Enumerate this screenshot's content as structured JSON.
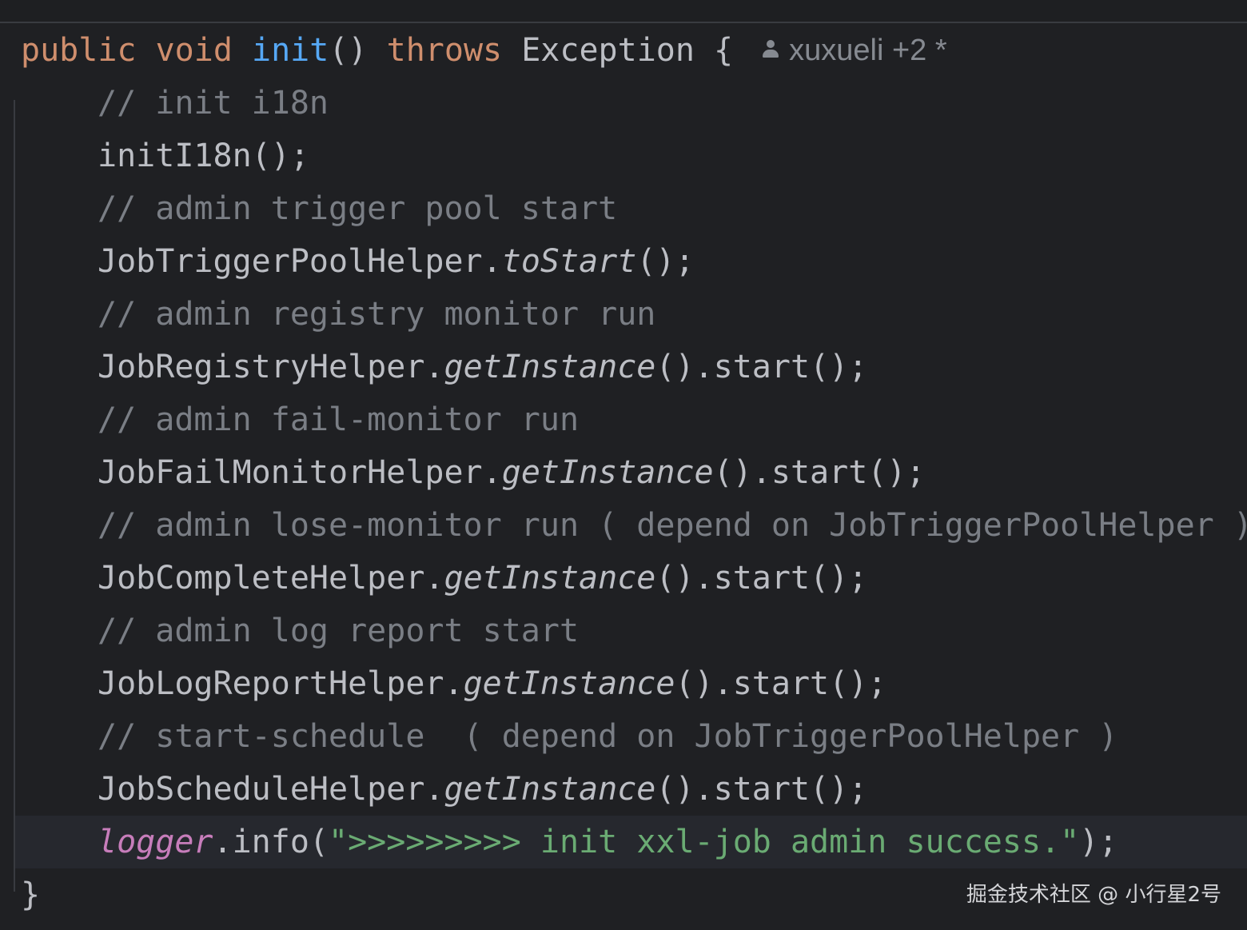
{
  "editor": {
    "decl": {
      "kw_public": "public",
      "kw_void": "void",
      "method_name": "init",
      "parens": "()",
      "kw_throws": "throws",
      "exception": "Exception",
      "open_brace": "{"
    },
    "author_hint": {
      "icon": "person-icon",
      "text": "xuxueli +2 *"
    },
    "lines": {
      "c1": "// init i18n",
      "s1": "initI18n();",
      "c2": "// admin trigger pool start",
      "s2_class": "JobTriggerPoolHelper.",
      "s2_call": "toStart",
      "s2_rest": "();",
      "c3": "// admin registry monitor run",
      "s3_class": "JobRegistryHelper.",
      "s3_call": "getInstance",
      "s3_rest": "().start();",
      "c4": "// admin fail-monitor run",
      "s4_class": "JobFailMonitorHelper.",
      "s4_call": "getInstance",
      "s4_rest": "().start();",
      "c5": "// admin lose-monitor run ( depend on JobTriggerPoolHelper )",
      "s5_class": "JobCompleteHelper.",
      "s5_call": "getInstance",
      "s5_rest": "().start();",
      "c6": "// admin log report start",
      "s6_class": "JobLogReportHelper.",
      "s6_call": "getInstance",
      "s6_rest": "().start();",
      "c7": "// start-schedule  ( depend on JobTriggerPoolHelper )",
      "s7_class": "JobScheduleHelper.",
      "s7_call": "getInstance",
      "s7_rest": "().start();",
      "log_field": "logger",
      "log_call": ".info(",
      "log_string": "\">>>>>>>>> init xxl-job admin success.\"",
      "log_end": ");",
      "close_brace": "}"
    }
  },
  "watermark": "掘金技术社区 @ 小行星2号",
  "colors": {
    "background": "#1f2023",
    "keyword": "#cf8e6d",
    "method_declaration": "#56a8f5",
    "comment": "#7a7e85",
    "field": "#c77dbb",
    "string": "#6aab73",
    "text": "#bcbec4"
  }
}
